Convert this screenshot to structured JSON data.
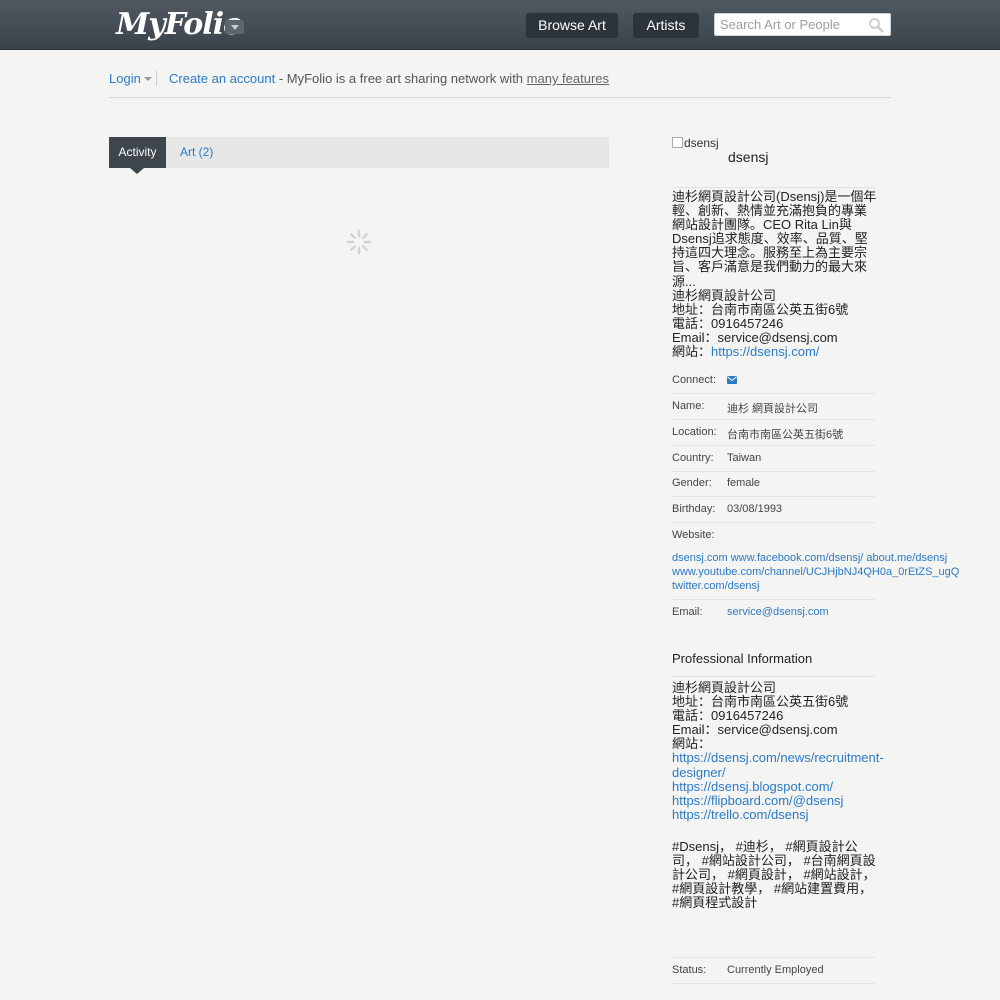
{
  "header": {
    "logo": "MyFolio",
    "nav": {
      "browse_art": "Browse Art",
      "artists": "Artists"
    },
    "search": {
      "placeholder": "Search Art or People"
    }
  },
  "loginbar": {
    "login": "Login",
    "create_account": "Create an account",
    "message": " - MyFolio is a free art sharing network with ",
    "features_link": "many features"
  },
  "tabs": {
    "activity": "Activity",
    "art": "Art (2)"
  },
  "profile": {
    "avatar_alt": "dsensj",
    "username": "dsensj",
    "bio": [
      "迪杉網頁設計公司(Dsensj)是一個年",
      "輕、創新、熱情並充滿抱負的專業",
      "網站設計團隊。CEO Rita Lin與",
      "Dsensj追求態度、效率、品質、堅",
      "持這四大理念。服務至上為主要宗",
      "旨、客戶滿意是我們動力的最大來",
      "源...",
      "迪杉網頁設計公司",
      "地址：台南市南區公英五街6號",
      "電話：0916457246",
      "Email：service@dsensj.com"
    ],
    "website_label": "網站：",
    "website_url": "https://dsensj.com/",
    "fields": {
      "connect_label": "Connect:",
      "name_label": "Name:",
      "name_value": "迪杉 網頁設計公司",
      "location_label": "Location:",
      "location_value": "台南市南區公英五街6號",
      "country_label": "Country:",
      "country_value": "Taiwan",
      "gender_label": "Gender:",
      "gender_value": "female",
      "birthday_label": "Birthday:",
      "birthday_value": "03/08/1993",
      "website_label": "Website:",
      "email_label": "Email:",
      "email_value": "service@dsensj.com"
    },
    "website_links": [
      "dsensj.com www.facebook.com/dsensj/ about.me/dsensj",
      "www.youtube.com/channel/UCJHjbNJ4QH0a_0rEtZS_ugQ",
      "twitter.com/dsensj"
    ],
    "professional": {
      "heading": "Professional Information",
      "lines": [
        "迪杉網頁設計公司",
        "地址：台南市南區公英五街6號",
        "電話：0916457246",
        "Email：service@dsensj.com",
        "網站："
      ],
      "links": [
        "https://dsensj.com/news/recruitment-",
        "designer/",
        "https://dsensj.blogspot.com/",
        "https://flipboard.com/@dsensj",
        "https://trello.com/dsensj"
      ],
      "tags": [
        "#Dsensj， #迪杉， #網頁設計公",
        "司， #網站設計公司， #台南網頁設",
        "計公司， #網頁設計， #網站設計，",
        "#網頁設計教學， #網站建置費用，",
        "#網頁程式設計"
      ]
    },
    "status_label": "Status:",
    "status_value": "Currently Employed"
  }
}
